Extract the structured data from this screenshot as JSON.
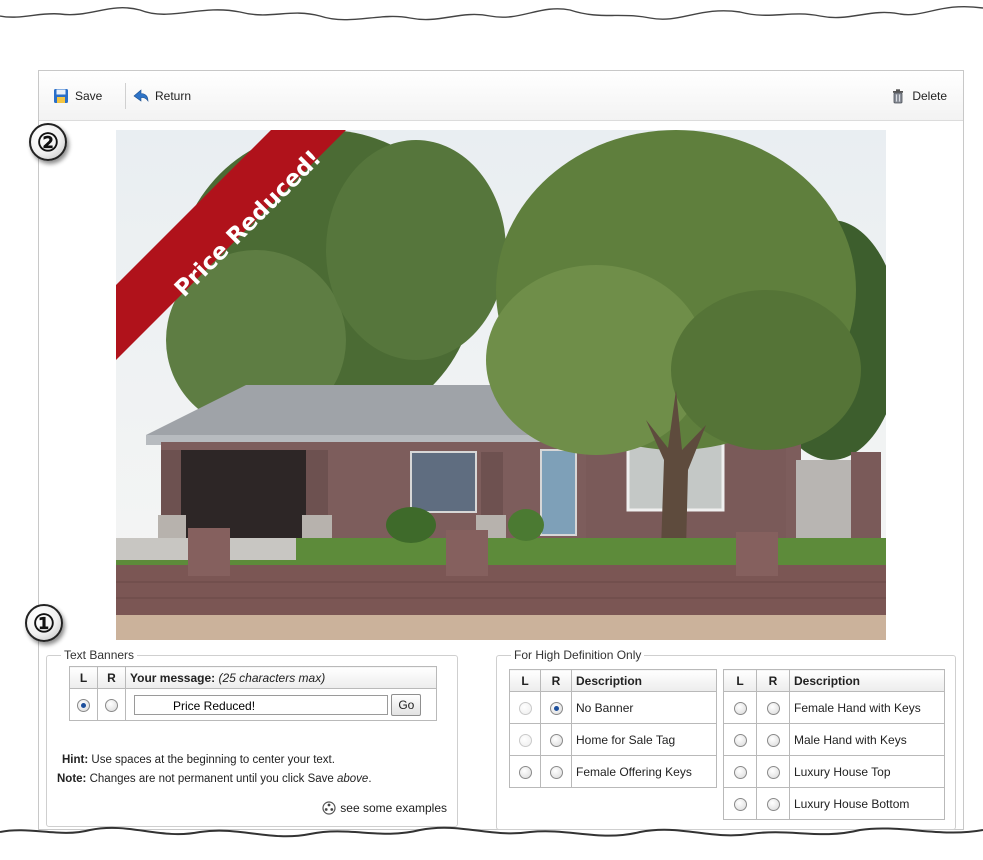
{
  "toolbar": {
    "save_label": "Save",
    "return_label": "Return",
    "delete_label": "Delete"
  },
  "callouts": [
    "①",
    "②"
  ],
  "photo": {
    "banner_text": "Price Reduced!"
  },
  "text_banners": {
    "legend": "Text Banners",
    "headers": {
      "l": "L",
      "r": "R",
      "message": "Your message:",
      "message_hint": "(25 characters max)"
    },
    "selected_side": "L",
    "message_value": "Price Reduced!",
    "go_label": "Go",
    "hint_label": "Hint:",
    "hint_text": "Use spaces at the beginning to center your text.",
    "note_label": "Note:",
    "note_text": "Changes are not permanent until you click Save",
    "note_emphasis": "above",
    "examples_link": "see some examples"
  },
  "hd": {
    "legend": "For High Definition Only",
    "headers": {
      "l": "L",
      "r": "R",
      "description": "Description"
    },
    "left_table": [
      {
        "description": "No Banner",
        "l": "disabled",
        "r": "checked"
      },
      {
        "description": "Home for Sale Tag",
        "l": "disabled",
        "r": "unchecked"
      },
      {
        "description": "Female Offering Keys",
        "l": "unchecked",
        "r": "unchecked"
      }
    ],
    "right_table": [
      {
        "description": "Female Hand with Keys",
        "l": "unchecked",
        "r": "unchecked"
      },
      {
        "description": "Male Hand with Keys",
        "l": "unchecked",
        "r": "unchecked"
      },
      {
        "description": "Luxury House Top",
        "l": "unchecked",
        "r": "unchecked"
      },
      {
        "description": "Luxury House Bottom",
        "l": "unchecked",
        "r": "unchecked"
      }
    ]
  },
  "colors": {
    "banner_red": "#b0121b",
    "radio_dot": "#1d4f9c",
    "panel_border": "#c8c8c8"
  }
}
